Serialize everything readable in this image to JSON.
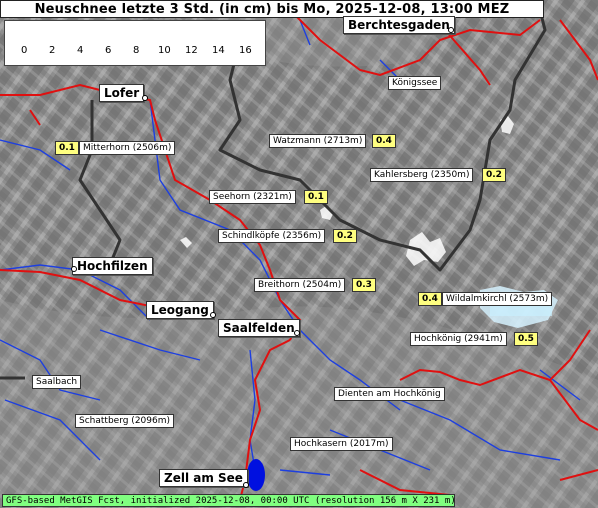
{
  "title": "Neuschnee letzte 3 Std. (in cm) bis Mo, 2025-12-08, 13:00 MEZ",
  "legend": {
    "ticks": [
      "0",
      "2",
      "4",
      "6",
      "8",
      "10",
      "12",
      "14",
      "16"
    ],
    "colors": [
      "#aaaaaa",
      "#c8f0ff",
      "#9fd6ff",
      "#6aaeff",
      "#3a7cf0",
      "#d8a8f0",
      "#c488ee",
      "#b06ae8",
      "#9a33e0"
    ]
  },
  "cities": [
    {
      "name": "Berchtesgaden"
    },
    {
      "name": "Lofer"
    },
    {
      "name": "Hochfilzen"
    },
    {
      "name": "Leogang"
    },
    {
      "name": "Saalfelden"
    },
    {
      "name": "Zell am See"
    }
  ],
  "places": [
    {
      "name": "Königssee"
    },
    {
      "name": "Saalbach"
    },
    {
      "name": "Schattberg (2096m)"
    },
    {
      "name": "Dienten am Hochkönig"
    },
    {
      "name": "Hochkasern (2017m)"
    }
  ],
  "peaks": [
    {
      "name": "Mitterhorn (2506m)",
      "value": "0.1"
    },
    {
      "name": "Watzmann (2713m)",
      "value": "0.4"
    },
    {
      "name": "Kahlersberg (2350m)",
      "value": "0.2"
    },
    {
      "name": "Seehorn (2321m)",
      "value": "0.1"
    },
    {
      "name": "Schindlköpfe (2356m)",
      "value": "0.2"
    },
    {
      "name": "Breithorn (2504m)",
      "value": "0.3"
    },
    {
      "name": "Wildalmkirchl (2573m)",
      "value": "0.4"
    },
    {
      "name": "Hochkönig (2941m)",
      "value": "0.5"
    }
  ],
  "footer": "GFS-based MetGIS Fcst, initialized 2025-12-08, 00:00 UTC  (resolution 156 m X 231 m)"
}
